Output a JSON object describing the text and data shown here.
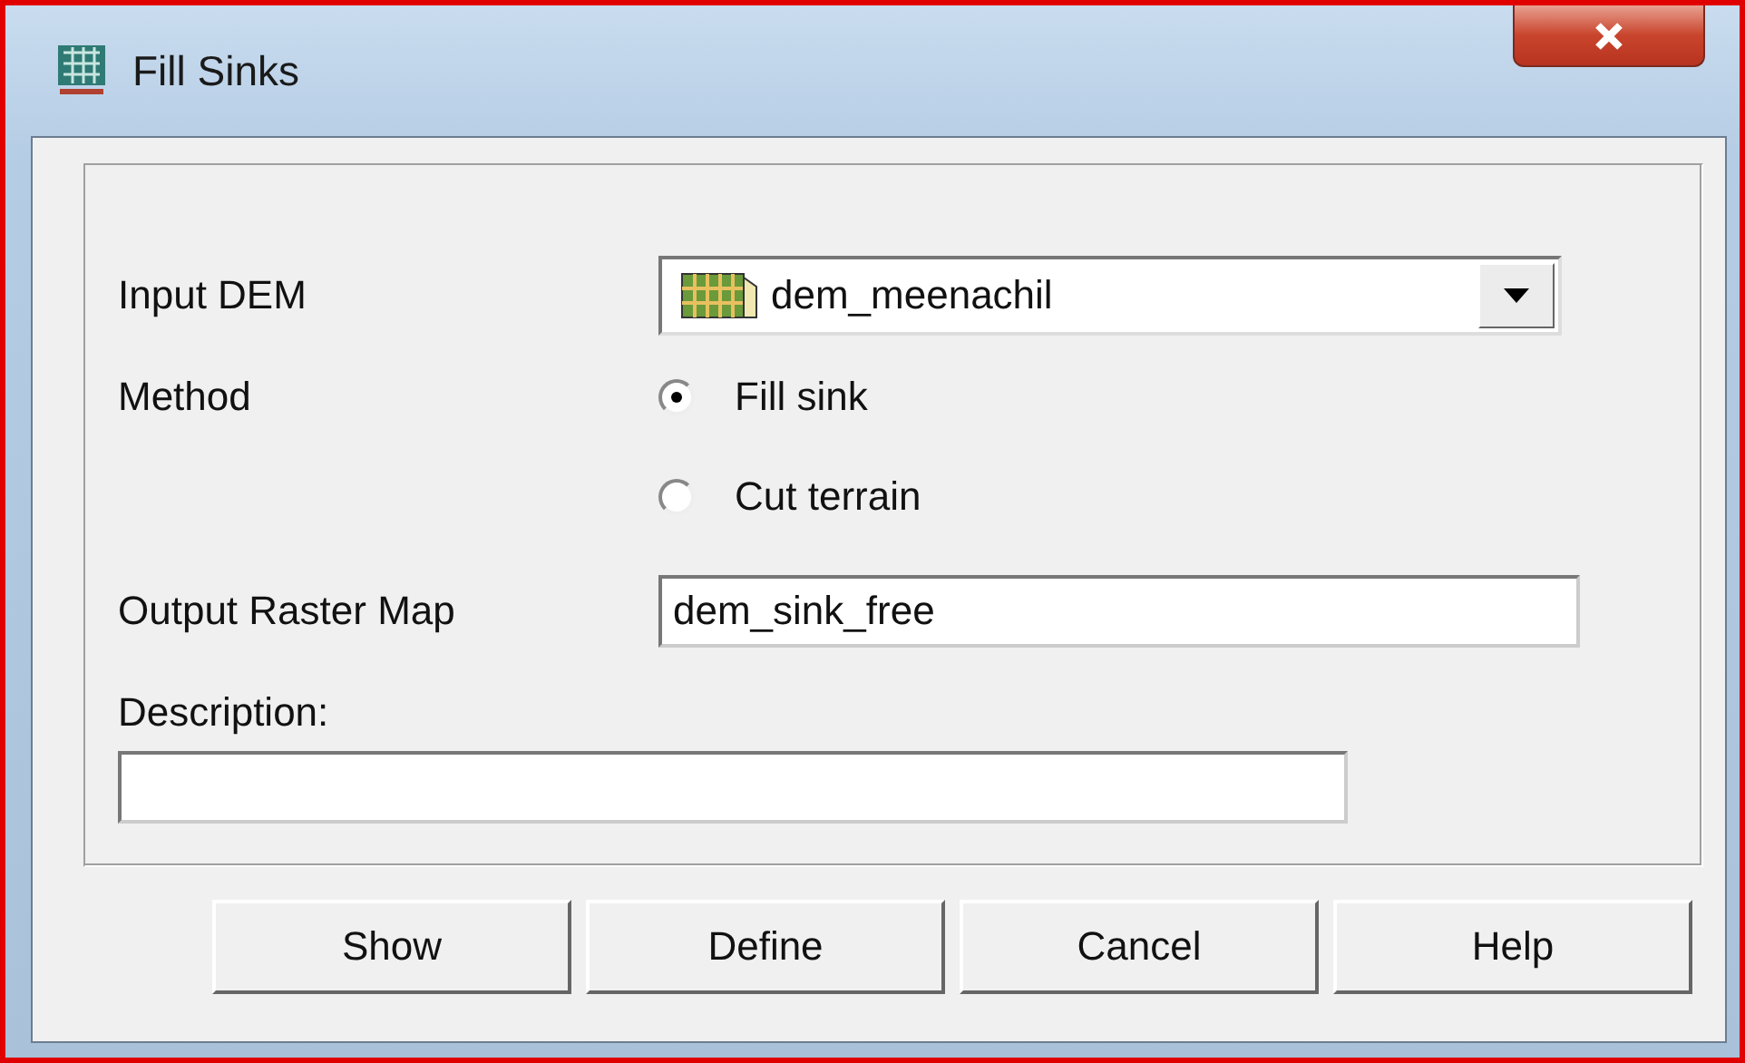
{
  "window": {
    "title": "Fill Sinks"
  },
  "input_dem": {
    "label": "Input DEM",
    "value": "dem_meenachil"
  },
  "method": {
    "label": "Method",
    "options": [
      {
        "label": "Fill sink",
        "selected": true
      },
      {
        "label": "Cut terrain",
        "selected": false
      }
    ]
  },
  "output_raster_map": {
    "label": "Output Raster Map",
    "value": "dem_sink_free"
  },
  "description": {
    "label": "Description:"
  },
  "buttons": [
    "Show",
    "Define",
    "Cancel",
    "Help"
  ]
}
